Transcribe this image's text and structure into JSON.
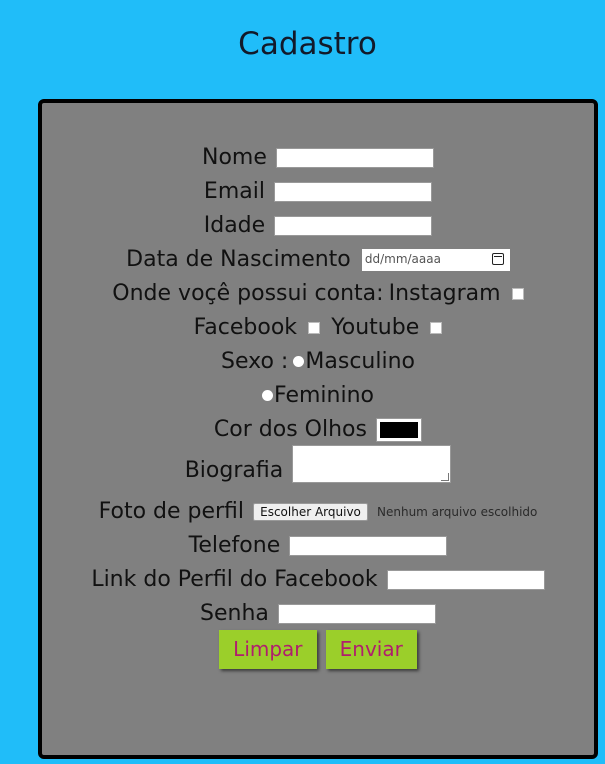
{
  "page": {
    "title": "Cadastro"
  },
  "form": {
    "nome_label": "Nome",
    "email_label": "Email",
    "idade_label": "Idade",
    "nascimento_label": "Data de Nascimento",
    "nascimento_placeholder": "dd/mm/aaaa",
    "contas_label": "Onde voçê possui conta:",
    "instagram_label": "Instagram",
    "facebook_label": "Facebook",
    "youtube_label": "Youtube",
    "sexo_label": "Sexo :",
    "masculino_label": "Masculino",
    "feminino_label": "Feminino",
    "olhos_label": "Cor dos Olhos",
    "olhos_color": "#000000",
    "biografia_label": "Biografia",
    "foto_label": "Foto de perfil",
    "file_button": "Escolher Arquivo",
    "file_status": "Nenhum arquivo escolhido",
    "telefone_label": "Telefone",
    "link_label": "Link do Perfil do Facebook",
    "senha_label": "Senha",
    "limpar_button": "Limpar",
    "enviar_button": "Enviar"
  },
  "colors": {
    "page_background": "#20bdf9",
    "panel_background": "#808080",
    "button_background": "#9bcf2a",
    "button_text": "#b01e6e"
  }
}
